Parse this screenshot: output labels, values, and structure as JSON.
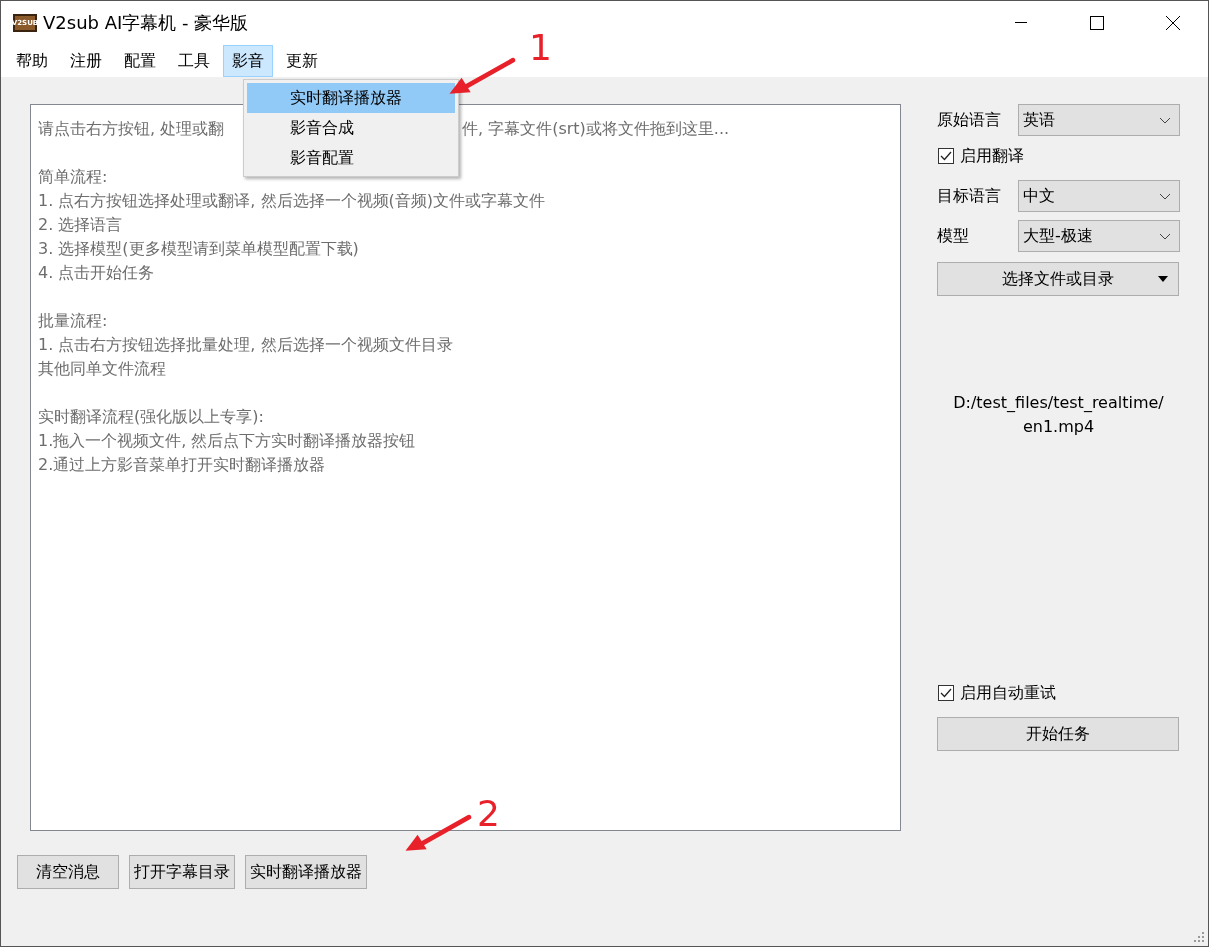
{
  "window": {
    "logo_text": "V2SUB",
    "title": "V2sub AI字幕机 - 豪华版"
  },
  "menu": [
    {
      "label": "帮助",
      "selected": false
    },
    {
      "label": "注册",
      "selected": false
    },
    {
      "label": "配置",
      "selected": false
    },
    {
      "label": "工具",
      "selected": false
    },
    {
      "label": "影音",
      "selected": true
    },
    {
      "label": "更新",
      "selected": false
    }
  ],
  "dropdown": [
    {
      "label": "实时翻译播放器",
      "selected": true
    },
    {
      "label": "影音合成",
      "selected": false
    },
    {
      "label": "影音配置",
      "selected": false
    }
  ],
  "message": {
    "intro": [
      "请点击右方按钮, 处理或翻",
      "件, 字幕文件(srt)或将文件拖到这里..."
    ],
    "sections": [
      {
        "lines": [
          "简单流程:",
          "1. 点右方按钮选择处理或翻译, 然后选择一个视频(音频)文件或字幕文件",
          "2. 选择语言",
          "3. 选择模型(更多模型请到菜单模型配置下载)",
          "4. 点击开始任务"
        ]
      },
      {
        "lines": [
          "批量流程:",
          "1. 点击右方按钮选择批量处理, 然后选择一个视频文件目录",
          "其他同单文件流程"
        ]
      },
      {
        "lines": [
          "实时翻译流程(强化版以上专享):",
          "1.拖入一个视频文件, 然后点下方实时翻译播放器按钮",
          "2.通过上方影音菜单打开实时翻译播放器"
        ]
      }
    ]
  },
  "source_language": {
    "label": "原始语言",
    "value": "英语"
  },
  "enable_translation": {
    "label": "启用翻译",
    "checked": true
  },
  "target_language": {
    "label": "目标语言",
    "value": "中文"
  },
  "model": {
    "label": "模型",
    "value": "大型-极速"
  },
  "choose_button": {
    "label": "选择文件或目录"
  },
  "file_path": [
    "D:/test_files/test_realtime/",
    "en1.mp4"
  ],
  "auto_retry": {
    "label": "启用自动重试",
    "checked": true
  },
  "start_button": {
    "label": "开始任务"
  },
  "bottom_buttons": [
    "清空消息",
    "打开字幕目录",
    "实时翻译播放器"
  ],
  "annotations": [
    "1",
    "2"
  ]
}
